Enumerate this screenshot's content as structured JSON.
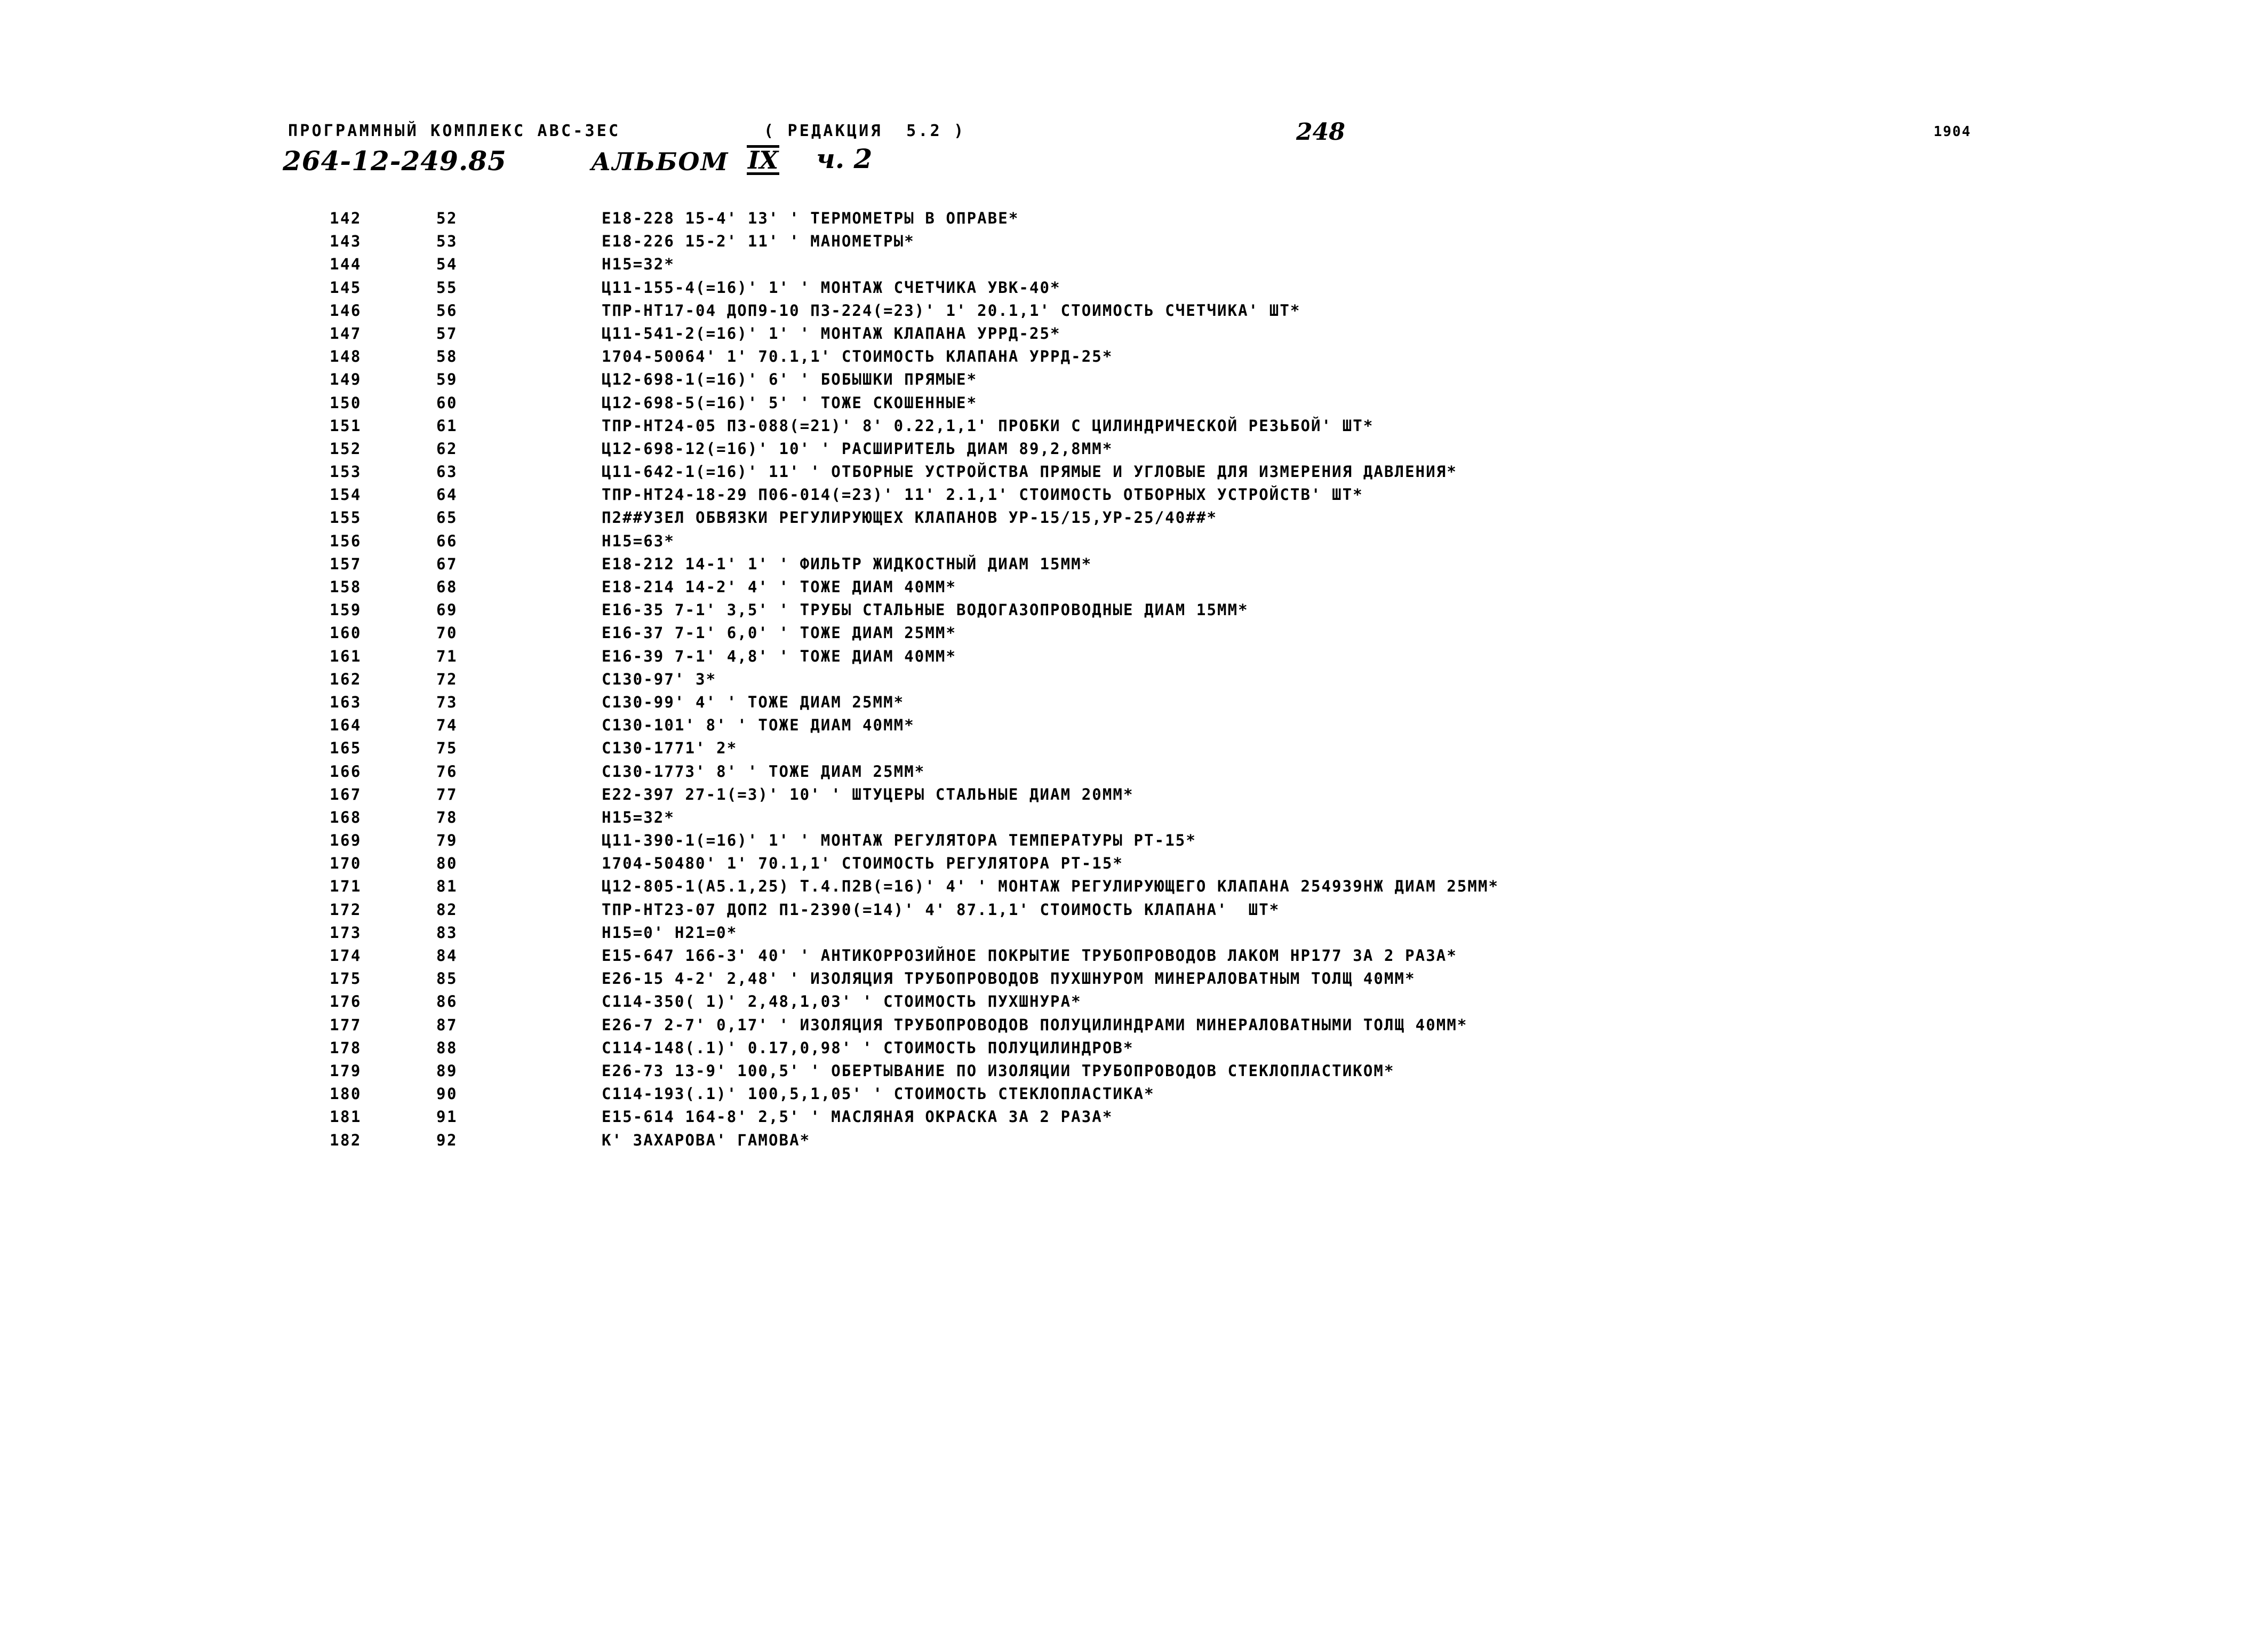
{
  "header": {
    "system_title": "ПРОГРАММНЫЙ КОМПЛЕКС АВС-3ЕС",
    "revision": "( РЕДАКЦИЯ  5.2 )",
    "page_number": "248",
    "corner_number": "1904",
    "document_code": "264-12-249.85",
    "album_label": "АЛЬБОМ",
    "album_roman": "IX",
    "part_label": "ч. 2"
  },
  "listing": {
    "rows": [
      {
        "seq": "142",
        "num": "52",
        "text": "Е18-228 15-4' 13' ' ТЕРМОМЕТРЫ В ОПРАВЕ*"
      },
      {
        "seq": "143",
        "num": "53",
        "text": "Е18-226 15-2' 11' ' МАНОМЕТРЫ*"
      },
      {
        "seq": "144",
        "num": "54",
        "text": "Н15=32*"
      },
      {
        "seq": "145",
        "num": "55",
        "text": "Ц11-155-4(=16)' 1' ' МОНТАЖ СЧЕТЧИКА УВК-40*"
      },
      {
        "seq": "146",
        "num": "56",
        "text": "ТПР-НТ17-04 ДОП9-10 П3-224(=23)' 1' 20.1,1' СТОИМОСТЬ СЧЕТЧИКА' ШТ*"
      },
      {
        "seq": "147",
        "num": "57",
        "text": "Ц11-541-2(=16)' 1' ' МОНТАЖ КЛАПАНА УРРД-25*"
      },
      {
        "seq": "148",
        "num": "58",
        "text": "1704-50064' 1' 70.1,1' СТОИМОСТЬ КЛАПАНА УРРД-25*"
      },
      {
        "seq": "149",
        "num": "59",
        "text": "Ц12-698-1(=16)' 6' ' БОБЫШКИ ПРЯМЫЕ*"
      },
      {
        "seq": "150",
        "num": "60",
        "text": "Ц12-698-5(=16)' 5' ' ТОЖЕ СКОШЕННЫЕ*"
      },
      {
        "seq": "151",
        "num": "61",
        "text": "ТПР-НТ24-05 П3-088(=21)' 8' 0.22,1,1' ПРОБКИ С ЦИЛИНДРИЧЕСКОЙ РЕЗЬБОЙ' ШТ*"
      },
      {
        "seq": "152",
        "num": "62",
        "text": "Ц12-698-12(=16)' 10' ' РАСШИРИТЕЛЬ ДИАМ 89,2,8ММ*"
      },
      {
        "seq": "153",
        "num": "63",
        "text": "Ц11-642-1(=16)' 11' ' ОТБОРНЫЕ УСТРОЙСТВА ПРЯМЫЕ И УГЛОВЫЕ ДЛЯ ИЗМЕРЕНИЯ ДАВЛЕНИЯ*"
      },
      {
        "seq": "154",
        "num": "64",
        "text": "ТПР-НТ24-18-29 П06-014(=23)' 11' 2.1,1' СТОИМОСТЬ ОТБОРНЫХ УСТРОЙСТВ' ШТ*"
      },
      {
        "seq": "155",
        "num": "65",
        "text": "П2##УЗЕЛ ОБВЯЗКИ РЕГУЛИРУЮЩЕХ КЛАПАНОВ УР-15/15,УР-25/40##*"
      },
      {
        "seq": "156",
        "num": "66",
        "text": "Н15=63*"
      },
      {
        "seq": "157",
        "num": "67",
        "text": "Е18-212 14-1' 1' ' ФИЛЬТР ЖИДКОСТНЫЙ ДИАМ 15ММ*"
      },
      {
        "seq": "158",
        "num": "68",
        "text": "Е18-214 14-2' 4' ' ТОЖЕ ДИАМ 40ММ*"
      },
      {
        "seq": "159",
        "num": "69",
        "text": "Е16-35 7-1' 3,5' ' ТРУБЫ СТАЛЬНЫЕ ВОДОГАЗОПРОВОДНЫЕ ДИАМ 15ММ*"
      },
      {
        "seq": "160",
        "num": "70",
        "text": "Е16-37 7-1' 6,0' ' ТОЖЕ ДИАМ 25ММ*"
      },
      {
        "seq": "161",
        "num": "71",
        "text": "Е16-39 7-1' 4,8' ' ТОЖЕ ДИАМ 40ММ*"
      },
      {
        "seq": "162",
        "num": "72",
        "text": "С130-97' 3*"
      },
      {
        "seq": "163",
        "num": "73",
        "text": "С130-99' 4' ' ТОЖЕ ДИАМ 25ММ*"
      },
      {
        "seq": "164",
        "num": "74",
        "text": "С130-101' 8' ' ТОЖЕ ДИАМ 40ММ*"
      },
      {
        "seq": "165",
        "num": "75",
        "text": "С130-1771' 2*"
      },
      {
        "seq": "166",
        "num": "76",
        "text": "С130-1773' 8' ' ТОЖЕ ДИАМ 25ММ*"
      },
      {
        "seq": "167",
        "num": "77",
        "text": "Е22-397 27-1(=3)' 10' ' ШТУЦЕРЫ СТАЛЬНЫЕ ДИАМ 20ММ*"
      },
      {
        "seq": "168",
        "num": "78",
        "text": "Н15=32*"
      },
      {
        "seq": "169",
        "num": "79",
        "text": "Ц11-390-1(=16)' 1' ' МОНТАЖ РЕГУЛЯТОРА ТЕМПЕРАТУРЫ РТ-15*"
      },
      {
        "seq": "170",
        "num": "80",
        "text": "1704-50480' 1' 70.1,1' СТОИМОСТЬ РЕГУЛЯТОРА РТ-15*"
      },
      {
        "seq": "171",
        "num": "81",
        "text": "Ц12-805-1(А5.1,25) Т.4.П2В(=16)' 4' ' МОНТАЖ РЕГУЛИРУЮЩЕГО КЛАПАНА 254939НЖ ДИАМ 25ММ*"
      },
      {
        "seq": "172",
        "num": "82",
        "text": "ТПР-НТ23-07 ДОП2 П1-2390(=14)' 4' 87.1,1' СТОИМОСТЬ КЛАПАНА'  ШТ*"
      },
      {
        "seq": "173",
        "num": "83",
        "text": "Н15=0' Н21=0*"
      },
      {
        "seq": "174",
        "num": "84",
        "text": "Е15-647 166-3' 40' ' АНТИКОРРОЗИЙНОЕ ПОКРЫТИЕ ТРУБОПРОВОДОВ ЛАКОМ НР177 ЗА 2 РАЗА*"
      },
      {
        "seq": "175",
        "num": "85",
        "text": "Е26-15 4-2' 2,48' ' ИЗОЛЯЦИЯ ТРУБОПРОВОДОВ ПУХШНУРОМ МИНЕРАЛОВАТНЫМ ТОЛЩ 40ММ*"
      },
      {
        "seq": "176",
        "num": "86",
        "text": "С114-350( 1)' 2,48,1,03' ' СТОИМОСТЬ ПУХШНУРА*"
      },
      {
        "seq": "177",
        "num": "87",
        "text": "Е26-7 2-7' 0,17' ' ИЗОЛЯЦИЯ ТРУБОПРОВОДОВ ПОЛУЦИЛИНДРАМИ МИНЕРАЛОВАТНЫМИ ТОЛЩ 40ММ*"
      },
      {
        "seq": "178",
        "num": "88",
        "text": "С114-148(.1)' 0.17,0,98' ' СТОИМОСТЬ ПОЛУЦИЛИНДРОВ*"
      },
      {
        "seq": "179",
        "num": "89",
        "text": "Е26-73 13-9' 100,5' ' ОБЕРТЫВАНИЕ ПО ИЗОЛЯЦИИ ТРУБОПРОВОДОВ СТЕКЛОПЛАСТИКОМ*"
      },
      {
        "seq": "180",
        "num": "90",
        "text": "С114-193(.1)' 100,5,1,05' ' СТОИМОСТЬ СТЕКЛОПЛАСТИКА*"
      },
      {
        "seq": "181",
        "num": "91",
        "text": "Е15-614 164-8' 2,5' ' МАСЛЯНАЯ ОКРАСКА ЗА 2 РАЗА*"
      },
      {
        "seq": "182",
        "num": "92",
        "text": "К' ЗАХАРОВА' ГАМОВА*"
      }
    ]
  }
}
